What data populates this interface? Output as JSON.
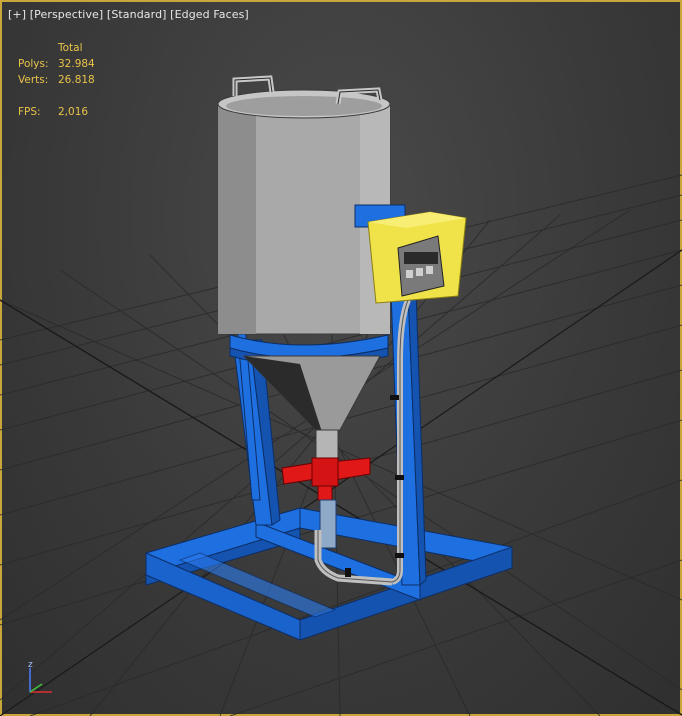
{
  "viewport": {
    "label_plus": "[+]",
    "label_view": "[Perspective]",
    "label_shading": "[Standard]",
    "label_display": "[Edged Faces]"
  },
  "stats": {
    "header": "Total",
    "polys_label": "Polys:",
    "polys_value": "32.984",
    "verts_label": "Verts:",
    "verts_value": "26.818",
    "fps_label": "FPS:",
    "fps_value": "2,016"
  },
  "axis": {
    "z_label": "z",
    "x_color": "#e03030",
    "y_color": "#40c040",
    "z_color": "#4a7aff"
  },
  "colors": {
    "frame": "#1e6fe0",
    "frame_shade": "#1553b0",
    "tank": "#a9a9a9",
    "cone": "#9a9a9a",
    "selected": "#f0e34a",
    "valve": "#e01818",
    "viewport_border": "#c9a63a"
  }
}
